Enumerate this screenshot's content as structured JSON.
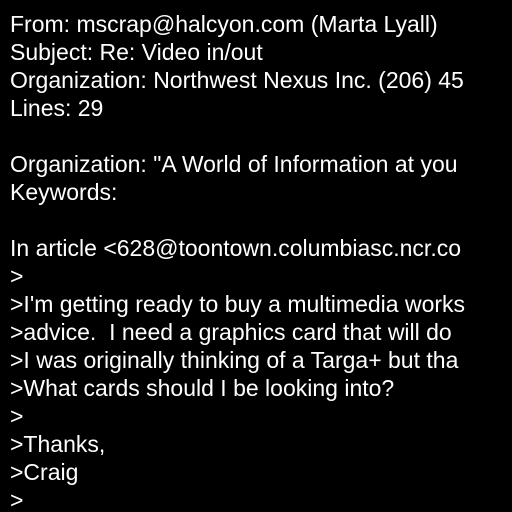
{
  "message": {
    "lines": [
      "From: mscrap@halcyon.com (Marta Lyall)",
      "Subject: Re: Video in/out",
      "Organization: Northwest Nexus Inc. (206) 45",
      "Lines: 29",
      "",
      "Organization: \"A World of Information at you",
      "Keywords:",
      "",
      "In article <628@toontown.columbiasc.ncr.co",
      ">",
      ">I'm getting ready to buy a multimedia works",
      ">advice.  I need a graphics card that will do",
      ">I was originally thinking of a Targa+ but tha",
      ">What cards should I be looking into?",
      ">",
      ">Thanks,",
      ">Craig",
      ">"
    ]
  }
}
